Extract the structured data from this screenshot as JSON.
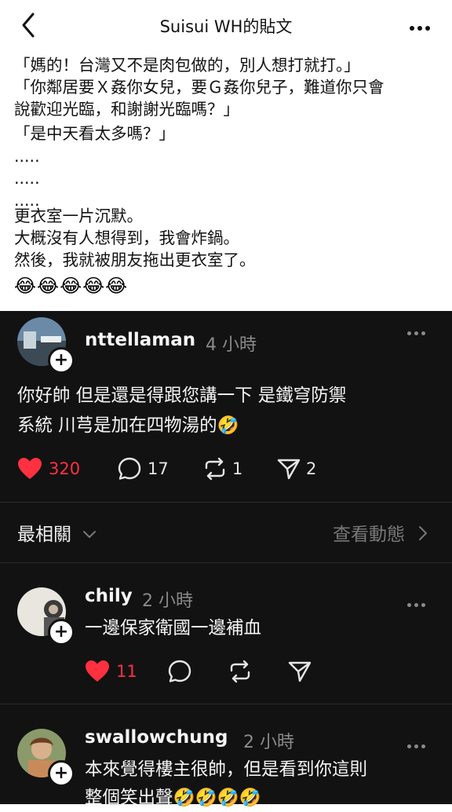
{
  "header": {
    "title": "Suisui WH的貼文"
  },
  "post": {
    "lines": [
      "「媽的！台灣又不是肉包做的，別人想打就打。」",
      "「你鄰居要Ｘ姦你女兒，要Ｇ姦你兒子，難道你只會",
      "說歡迎光臨，和謝謝光臨嗎？」",
      "「是中天看太多嗎？」",
      ".....",
      ".....",
      ".....",
      "更衣室一片沉默。",
      "大概沒有人想得到，我會炸鍋。",
      "然後，我就被朋友拖出更衣室了。"
    ],
    "emoji": "😂😂😂😂😂"
  },
  "comments": [
    {
      "username": "nttellaman",
      "time": "4 小時",
      "text_lines": [
        "你好帥 但是還是得跟您講一下 是鐵穹防禦",
        "系統 川芎是加在四物湯的🤣"
      ],
      "likes": "320",
      "replies": "17",
      "reposts": "1",
      "shares": "2"
    },
    {
      "username": "chily",
      "time": "2 小時",
      "text_lines": [
        "一邊保家衛國一邊補血"
      ],
      "likes": "11"
    },
    {
      "username": "swallowchung",
      "time": "2 小時",
      "text_lines": [
        "本來覺得樓主很帥，但是看到你這則",
        "整個笑出聲🤣🤣🤣🤣"
      ]
    }
  ],
  "sort": {
    "label": "最相關",
    "activity_label": "查看動態"
  },
  "colors": {
    "like": "#ff3040",
    "dark_bg": "#121212",
    "muted": "#8a8a8a"
  }
}
